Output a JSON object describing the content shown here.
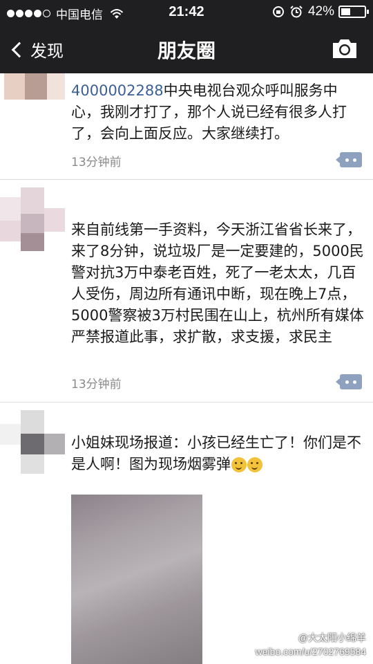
{
  "status_bar": {
    "carrier": "中国电信",
    "time": "21:42",
    "battery_percent": "42%",
    "battery_level": 0.42,
    "signal_bars_filled": 4,
    "signal_bars_total": 5
  },
  "nav": {
    "back_label": "发现",
    "title": "朋友圈",
    "camera_icon": "camera-icon"
  },
  "posts": [
    {
      "link_text": "4000002288",
      "text": "中央电视台观众呼叫服务中心，我刚才打了，那个人说已经有很多人打了，会向上面反应。大家继续打。",
      "time": "13分钟前"
    },
    {
      "text": "来自前线第一手资料，今天浙江省省长来了，来了8分钟，说垃圾厂是一定要建的，5000民警对抗3万中泰老百姓，死了一老太太，几百人受伤，周边所有通讯中断，现在晚上7点，5000警察被3万村民围在山上，杭州所有媒体严禁报道此事，求扩散，求支援，求民主",
      "time": "13分钟前"
    },
    {
      "text": "小姐妹现场报道：小孩已经生亡了！你们是不是人啊！图为现场烟雾弹",
      "emoji_count": 2
    }
  ],
  "watermark": {
    "line1": "@大太阳小绵羊",
    "line2": "weibo.com/u/2702769584"
  },
  "colors": {
    "bar_bg": "#1f1f22",
    "link": "#3b5f96",
    "time": "#8a8a8a",
    "comment_button": "#8ea2c0"
  }
}
